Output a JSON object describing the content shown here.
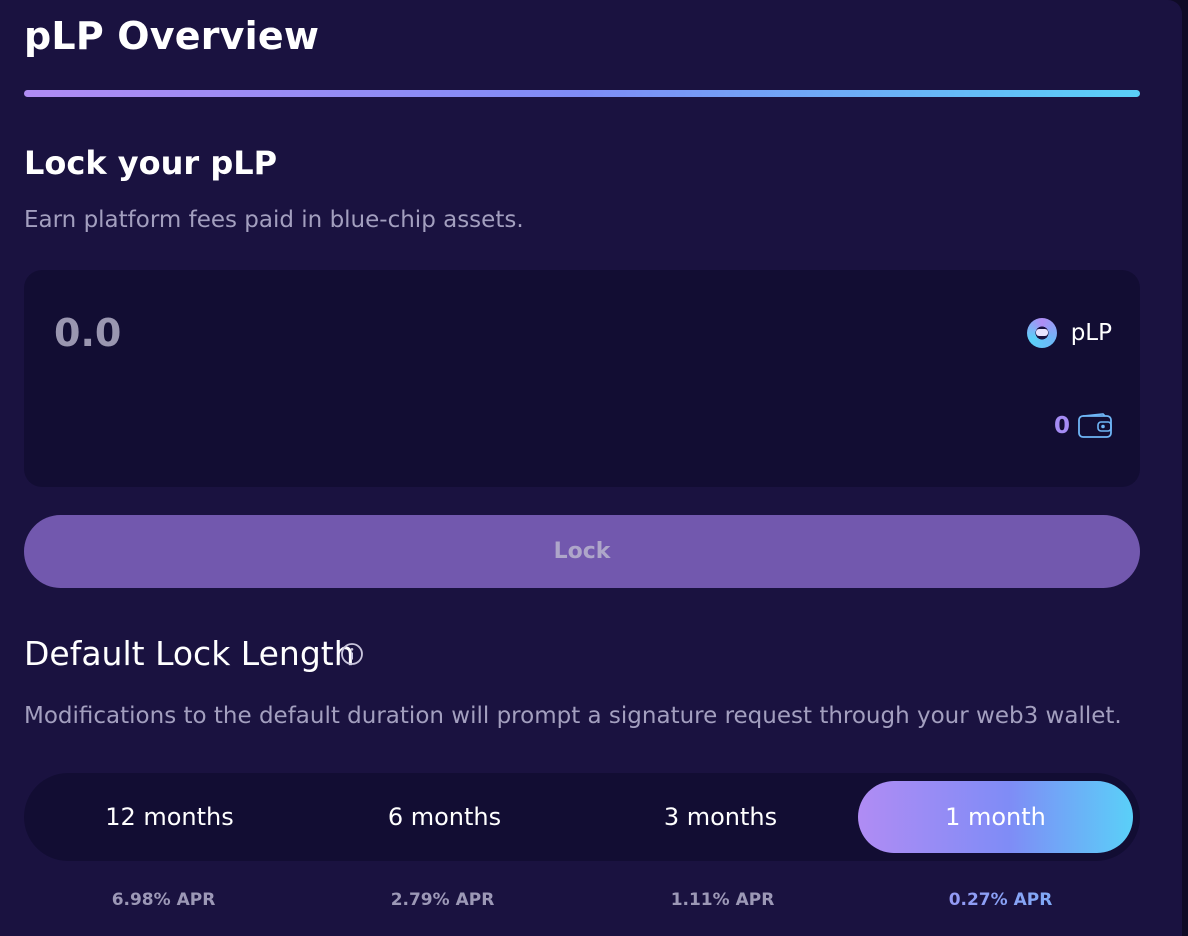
{
  "header": {
    "title": "pLP Overview"
  },
  "lock_section": {
    "title": "Lock your pLP",
    "subtitle": "Earn platform fees paid in blue-chip assets.",
    "amount_placeholder": "0.0",
    "token_label": "pLP",
    "token_icon": "plp-token-icon",
    "wallet_balance": "0",
    "wallet_icon": "wallet-icon",
    "lock_button_label": "Lock"
  },
  "default_lock": {
    "title": "Default Lock Length",
    "info_icon": "info-icon",
    "description": "Modifications to the default duration will prompt a signature request through your web3 wallet.",
    "options": [
      {
        "label": "12 months",
        "apr": "6.98% APR"
      },
      {
        "label": "6 months",
        "apr": "2.79% APR"
      },
      {
        "label": "3 months",
        "apr": "1.11% APR"
      },
      {
        "label": "1 month",
        "apr": "0.27% APR"
      }
    ],
    "selected": "1 month"
  },
  "colors": {
    "background": "#1a1240",
    "input_background": "#120d33",
    "accent_gradient_start": "#b08cf4",
    "accent_gradient_end": "#5ad0f8",
    "lock_button": "#7258ae"
  }
}
